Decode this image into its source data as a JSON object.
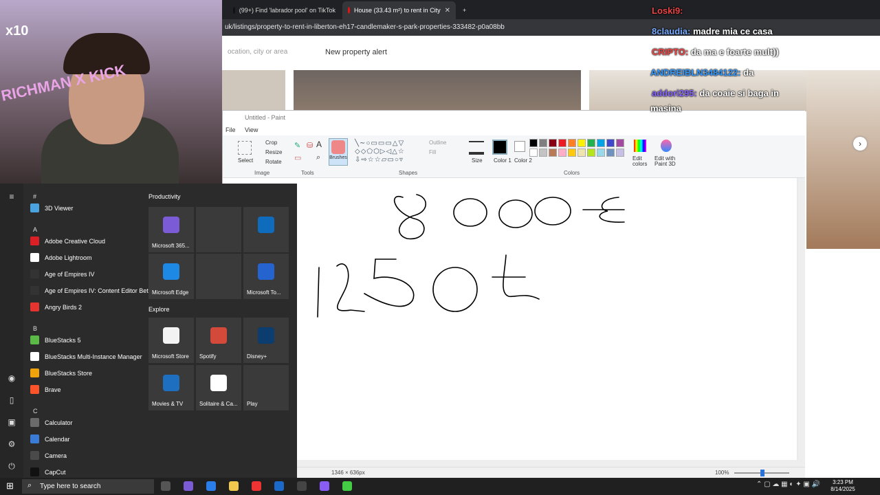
{
  "browser": {
    "tabs": [
      {
        "label": "(99+) Find 'labrador pool' on TikTok"
      },
      {
        "label": "House (33.43 m²) to rent in City"
      }
    ],
    "new_tab": "+",
    "address": "uk/listings/property-to-rent-in-liberton-eh17-candlemaker-s-park-properties-333482-p0a08bb",
    "site_search_placeholder": "ocation, city or area",
    "site_alert": "New property alert"
  },
  "paint": {
    "title": "Untitled - Paint",
    "tabs": [
      "File",
      "View"
    ],
    "groups": {
      "image": "Image",
      "tools": "Tools",
      "shapes": "Shapes",
      "colors": "Colors"
    },
    "buttons": {
      "select": "Select",
      "crop": "Crop",
      "resize": "Resize",
      "rotate": "Rotate",
      "brushes": "Brushes",
      "outline": "Outline",
      "fill": "Fill",
      "size": "Size",
      "color1": "Color 1",
      "color2": "Color 2",
      "edit_colors": "Edit colors",
      "edit_paint3d": "Edit with Paint 3D"
    },
    "palette": [
      "#000000",
      "#7f7f7f",
      "#880015",
      "#ed1c24",
      "#ff7f27",
      "#fff200",
      "#22b14c",
      "#00a2e8",
      "#3f48cc",
      "#a349a4",
      "#ffffff",
      "#c3c3c3",
      "#b97a57",
      "#ffaec9",
      "#ffc90e",
      "#efe4b0",
      "#b5e61d",
      "#99d9ea",
      "#7092be",
      "#c8bfe7"
    ],
    "canvas_text": {
      "line1": "8 000 €",
      "line2": "1250 £"
    },
    "status": {
      "size": "1346 × 636px",
      "zoom": "100%"
    }
  },
  "start_menu": {
    "rail": [
      "menu-icon",
      "user-icon",
      "document-icon",
      "picture-icon",
      "settings-icon",
      "power-icon"
    ],
    "letters": {
      "hash": "#",
      "a": "A",
      "b": "B",
      "c": "C"
    },
    "apps": [
      {
        "label": "3D Viewer",
        "color": "#4aa3df"
      },
      {
        "label": "Adobe Creative Cloud",
        "color": "#da1f26"
      },
      {
        "label": "Adobe Lightroom",
        "color": "#ffffff"
      },
      {
        "label": "Age of Empires IV",
        "color": "#333333"
      },
      {
        "label": "Age of Empires IV: Content Editor Beta",
        "color": "#333333"
      },
      {
        "label": "Angry Birds 2",
        "color": "#e3342f"
      },
      {
        "label": "BlueStacks 5",
        "color": "#5bb947"
      },
      {
        "label": "BlueStacks Multi-Instance Manager",
        "color": "#ffffff"
      },
      {
        "label": "BlueStacks Store",
        "color": "#f0a30a"
      },
      {
        "label": "Brave",
        "color": "#fb542b"
      },
      {
        "label": "Calculator",
        "color": "#6b6b6b"
      },
      {
        "label": "Calendar",
        "color": "#3a7bd5"
      },
      {
        "label": "Camera",
        "color": "#4a4a4a"
      },
      {
        "label": "CapCut",
        "color": "#111111"
      }
    ],
    "sections": {
      "productivity": "Productivity",
      "explore": "Explore"
    },
    "tiles": [
      {
        "label": "Microsoft 365...",
        "color": "#7b5cd6"
      },
      {
        "label": "",
        "color": "#3a3a3a"
      },
      {
        "label": "",
        "color": "#0f6cbd"
      },
      {
        "label": "Microsoft Edge",
        "color": "#1e88e5"
      },
      {
        "label": "",
        "color": "#3a3a3a"
      },
      {
        "label": "Microsoft To...",
        "color": "#2564cf"
      },
      {
        "label": "Microsoft Store",
        "color": "#f3f3f3"
      },
      {
        "label": "Spotify",
        "color": "#d44a3a"
      },
      {
        "label": "Disney+",
        "color": "#0b3d6e"
      },
      {
        "label": "Movies & TV",
        "color": "#1e6fbf"
      },
      {
        "label": "Solitaire & Ca...",
        "color": "#ffffff"
      },
      {
        "label": "Play",
        "color": "#3a3a3a"
      }
    ]
  },
  "stream": {
    "x10": "x10",
    "overlay_text": "RICHMAN X KICK",
    "chat": [
      {
        "user": "Loski9:",
        "msg": ""
      },
      {
        "user": "8claudia:",
        "msg": "madre mia ce casa"
      },
      {
        "user": "CRIPTO:",
        "msg": "da ma e foarte mult))"
      },
      {
        "user": "ANDREIBLN3484122:",
        "msg": "da"
      },
      {
        "user": "addori295:",
        "msg": "da coaie si baga in"
      },
      {
        "user": "",
        "msg": "masina"
      }
    ]
  },
  "taskbar": {
    "search_placeholder": "Type here to search",
    "time": "3:23 PM",
    "date": "8/14/2025"
  }
}
